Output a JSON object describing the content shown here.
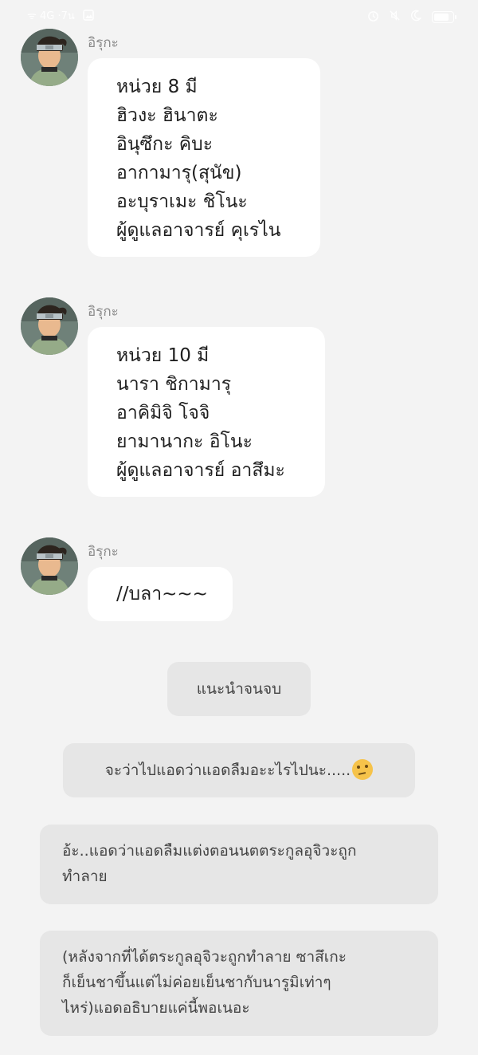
{
  "status_bar": {
    "left_text": "ᯤ 4G ·7น",
    "icons": [
      "signal-icon",
      "gallery-icon",
      "alarm-icon",
      "mute-icon",
      "moon-icon",
      "battery-icon"
    ]
  },
  "messages": [
    {
      "sender": "อิรุกะ",
      "lines": [
        "หน่วย 8 มี",
        "ฮิวงะ ฮินาตะ",
        "อินุซึกะ คิบะ",
        "อากามารุ(สุนัข)",
        "อะบุราเมะ ชิโนะ",
        "ผู้ดูแลอาจารย์ คุเรไน"
      ]
    },
    {
      "sender": "อิรุกะ",
      "lines": [
        "หน่วย 10 มี",
        "นารา ชิกามารุ",
        "อาคิมิจิ โจจิ",
        "ยามานากะ อิโนะ",
        "ผู้ดูแลอาจารย์ อาสึมะ"
      ]
    },
    {
      "sender": "อิรุกะ",
      "lines": [
        "//บลา~~~"
      ]
    }
  ],
  "choices": [
    {
      "lines": [
        "แนะนำจนจบ"
      ]
    },
    {
      "lines": [
        "จะว่าไปแอดว่าแอดลืมอะะไรไปนะ....."
      ],
      "emoji": "thinking-face-icon"
    },
    {
      "lines": [
        "อ้ะ..แอดว่าแอดลืมแต่งตอนนตตระกูลอุจิวะถูก",
        "ทำลาย"
      ]
    },
    {
      "lines": [
        "(หลังจากที่ได้ตระกูลอุจิวะถูกทำลาย ซาสึเกะ",
        "ก็เย็นชาขึ้นแต่ไม่ค่อยเย็นชากับนารูมิเท่าๆ",
        "ไหร่)แอดอธิบายแค่นี้พอเนอะ"
      ]
    }
  ]
}
